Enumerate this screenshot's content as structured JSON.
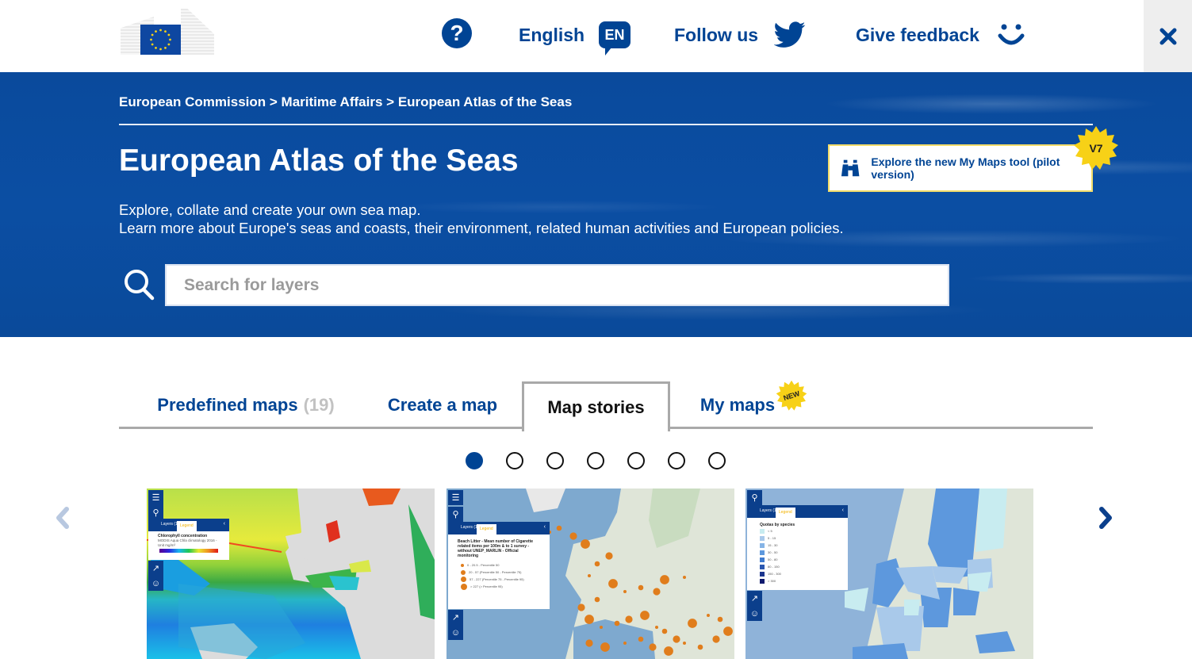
{
  "topbar": {
    "logo_alt": "European Commission",
    "help_icon": "question-circle-icon",
    "language_label": "English",
    "language_code": "EN",
    "follow_label": "Follow us",
    "follow_icon": "twitter-icon",
    "feedback_label": "Give feedback",
    "feedback_icon": "smiley-icon",
    "close_icon": "close-icon"
  },
  "hero": {
    "breadcrumb": [
      {
        "label": "European Commission"
      },
      {
        "label": "Maritime Affairs"
      },
      {
        "label": "European Atlas of the Seas"
      }
    ],
    "breadcrumb_separator": ">",
    "title": "European Atlas of the Seas",
    "description_line1": "Explore, collate and create your own sea map.",
    "description_line2": "Learn more about Europe's seas and coasts, their environment, related human activities and European policies.",
    "promo": {
      "text": "Explore the new My Maps tool (pilot version)",
      "icon": "binoculars-icon",
      "badge": "V7"
    },
    "search": {
      "placeholder": "Search for layers",
      "value": ""
    }
  },
  "tabs": [
    {
      "label": "Predefined maps",
      "count": "(19)",
      "active": false
    },
    {
      "label": "Create a map",
      "active": false
    },
    {
      "label": "Map stories",
      "active": true
    },
    {
      "label": "My maps",
      "badge": "NEW",
      "active": false
    }
  ],
  "carousel": {
    "page_count": 7,
    "active_page": 1,
    "prev_icon": "chevron-left-icon",
    "next_icon": "chevron-right-icon",
    "cards": [
      {
        "legend_tabs": [
          "Layers (1)",
          "Legend"
        ],
        "legend_title": "Chlorophyll concentration",
        "legend_subtitle": "MODIS Aqua Chla climatology 2016 - Unit mg/m³",
        "legend_type": "gradient"
      },
      {
        "legend_tabs": [
          "Layers (1)",
          "Legend"
        ],
        "legend_title": "Beach Litter - Mean number of Cigarette related items per 100m & to 1 survey - without UNEP_MARLIN - Official monitoring",
        "legend_items": [
          "0 - 20.5 - Percentile 50",
          "20 - 57 (Percentile 50 - Percentile 75)",
          "57 - 227 (Percentile 75 - Percentile 95)",
          "> 227 (> Percentile 95)"
        ]
      },
      {
        "legend_tabs": [
          "Layers (1)",
          "Legend"
        ],
        "legend_title": "Quotas by species",
        "legend_items": [
          "< 5",
          "5 - 15",
          "15 - 30",
          "30 - 50",
          "50 - 80",
          "80 - 150",
          "150 - 300",
          "> 300"
        ],
        "legend_colors": [
          "#c8ecf0",
          "#a9c9ea",
          "#86b4e6",
          "#5d98dd",
          "#3f7bcf",
          "#2a57b0",
          "#1c368f",
          "#0f1a6e"
        ]
      }
    ]
  },
  "colors": {
    "brand_blue": "#004494",
    "hero_blue": "#0b4ea3",
    "badge_yellow": "#f7d117",
    "tab_border": "#a9a9a9",
    "count_gray": "#c2c2c2"
  }
}
